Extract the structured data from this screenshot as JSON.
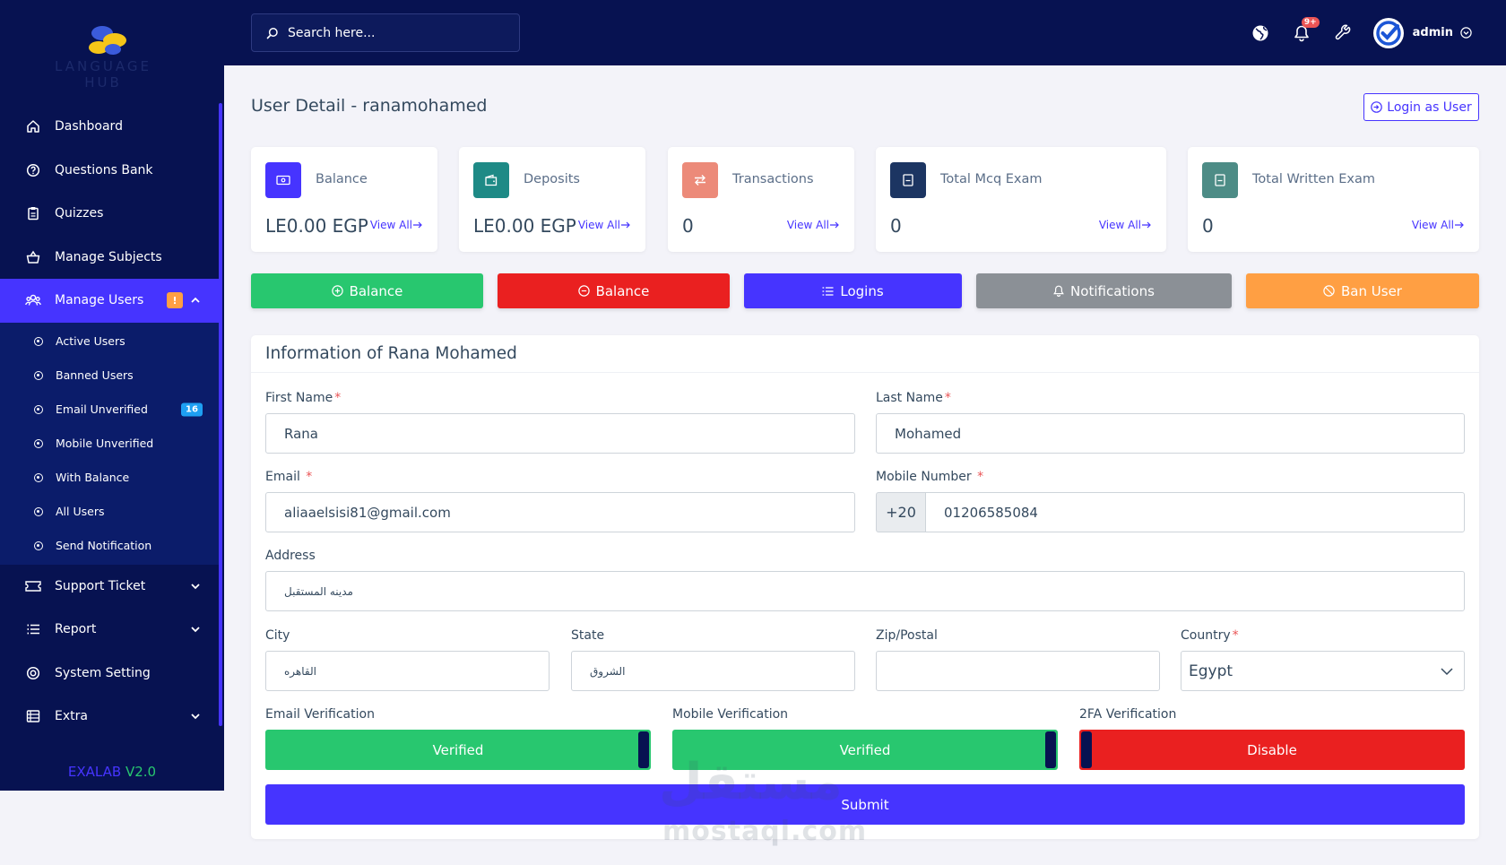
{
  "brand": {
    "logo_text": "LANGUAGE HUB",
    "version_name": "EXALAB",
    "version_number": "V2.0"
  },
  "search": {
    "placeholder": "Search here..."
  },
  "topbar": {
    "notification_count": "9+",
    "admin_name": "admin"
  },
  "sidebar": {
    "items": [
      {
        "label": "Dashboard",
        "icon": "home-icon"
      },
      {
        "label": "Questions Bank",
        "icon": "question-circle-icon"
      },
      {
        "label": "Quizzes",
        "icon": "clipboard-icon"
      },
      {
        "label": "Manage Subjects",
        "icon": "basket-icon"
      },
      {
        "label": "Manage Users",
        "icon": "users-icon",
        "badge": "!"
      },
      {
        "label": "Support Ticket",
        "icon": "ticket-icon"
      },
      {
        "label": "Report",
        "icon": "list-icon"
      },
      {
        "label": "System Setting",
        "icon": "settings-icon"
      },
      {
        "label": "Extra",
        "icon": "server-icon"
      }
    ],
    "sub_items": [
      {
        "label": "Active Users"
      },
      {
        "label": "Banned Users"
      },
      {
        "label": "Email Unverified",
        "badge": "16"
      },
      {
        "label": "Mobile Unverified"
      },
      {
        "label": "With Balance"
      },
      {
        "label": "All Users"
      },
      {
        "label": "Send Notification"
      }
    ]
  },
  "page": {
    "title": "User Detail - ranamohamed",
    "login_as_label": "Login as User"
  },
  "cards": [
    {
      "label": "Balance",
      "value": "LE0.00 EGP",
      "link": "View All",
      "color": "#4634ff"
    },
    {
      "label": "Deposits",
      "value": "LE0.00 EGP",
      "link": "View All",
      "color": "#1e8a86"
    },
    {
      "label": "Transactions",
      "value": "0",
      "link": "View All",
      "color": "#ec8a79"
    },
    {
      "label": "Total Mcq Exam",
      "value": "0",
      "link": "View All",
      "color": "#1c3562"
    },
    {
      "label": "Total Written Exam",
      "value": "0",
      "link": "View All",
      "color": "#4d8c86"
    }
  ],
  "actions": [
    {
      "label": "Balance",
      "color": "#28c76f"
    },
    {
      "label": "Balance",
      "color": "#ea2020"
    },
    {
      "label": "Logins",
      "color": "#4634ff"
    },
    {
      "label": "Notifications",
      "color": "#8b9096"
    },
    {
      "label": "Ban User",
      "color": "#ff9f43"
    }
  ],
  "form": {
    "title": "Information of Rana Mohamed",
    "first_name": {
      "label": "First Name",
      "value": "Rana"
    },
    "last_name": {
      "label": "Last Name",
      "value": "Mohamed"
    },
    "email": {
      "label": "Email",
      "value": "aliaaelsisi81@gmail.com"
    },
    "mobile": {
      "label": "Mobile Number",
      "prefix": "+20",
      "value": "01206585084"
    },
    "address": {
      "label": "Address",
      "value": "مدينه المستقبل"
    },
    "city": {
      "label": "City",
      "value": "القاهره"
    },
    "state": {
      "label": "State",
      "value": "الشروق"
    },
    "zip": {
      "label": "Zip/Postal",
      "value": ""
    },
    "country": {
      "label": "Country",
      "value": "Egypt"
    },
    "email_verification": {
      "label": "Email Verification",
      "state": "Verified"
    },
    "mobile_verification": {
      "label": "Mobile Verification",
      "state": "Verified"
    },
    "twofa_verification": {
      "label": "2FA Verification",
      "state": "Disable"
    },
    "submit_label": "Submit"
  },
  "watermark": {
    "arabic": "مستقل",
    "latin": "mostaql.com"
  },
  "colors": {
    "sidebar_bg": "#071251",
    "accent": "#4634ff",
    "success": "#28c76f",
    "danger": "#ea2020",
    "warning": "#ff9f43"
  }
}
